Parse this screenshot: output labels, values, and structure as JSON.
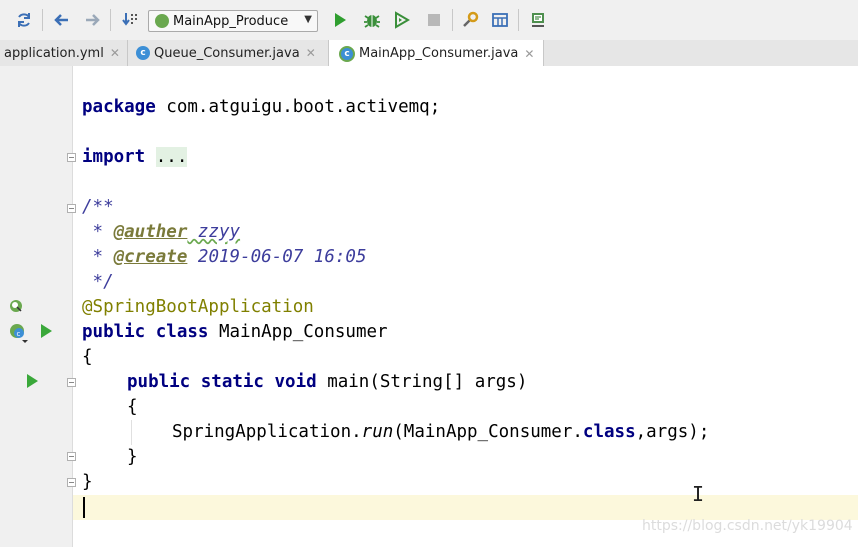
{
  "toolbar": {
    "run_config": "MainApp_Produce",
    "buttons": [
      "sync-icon",
      "back-icon",
      "forward-icon",
      "build-icon",
      "run-icon",
      "debug-icon",
      "coverage-icon",
      "stop-icon",
      "settings-icon",
      "project-structure-icon",
      "sdk-icon"
    ]
  },
  "tabs": [
    {
      "label": "application.yml",
      "active": false
    },
    {
      "label": "Queue_Consumer.java",
      "active": false
    },
    {
      "label": "MainApp_Consumer.java",
      "active": true
    }
  ],
  "code": {
    "package_kw": "package",
    "package_name": " com.atguigu.boot.activemq;",
    "import_kw": "import",
    "import_folded": "...",
    "doc_open": "/**",
    "doc_author_prefix": " * ",
    "doc_author_tag": "@auther",
    "doc_author_value": " zzyy",
    "doc_create_prefix": " * ",
    "doc_create_tag": "@create",
    "doc_create_value": " 2019-06-07 16:05",
    "doc_close": " */",
    "annotation": "@SpringBootApplication",
    "class_kw": "public class",
    "class_name": " MainApp_Consumer",
    "brace_open": "{",
    "method_kw": "public static void",
    "method_sig": " main(String[] args)",
    "method_brace_open": "{",
    "call_prefix": "SpringApplication.",
    "call_method": "run",
    "call_args_1": "(MainApp_Consumer.",
    "call_class_kw": "class",
    "call_args_2": ",args);",
    "method_brace_close": "}",
    "brace_close": "}"
  },
  "colors": {
    "keyword": "#000080",
    "annotation": "#808000",
    "doc_comment": "#3d3d9c",
    "current_line": "#fcf8dc",
    "run_green": "#3aa83a"
  },
  "watermark": "https://blog.csdn.net/yk19904"
}
